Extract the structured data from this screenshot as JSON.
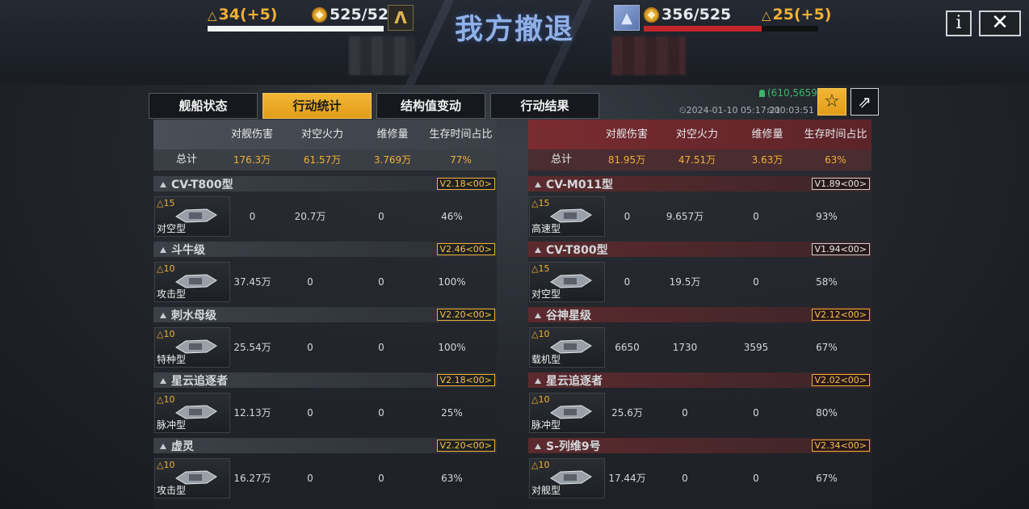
{
  "header": {
    "title": "我方撤退",
    "left": {
      "energy": "34(+5)",
      "hp": "525/525",
      "hp_fraction": 1.0,
      "emblem": "Λ"
    },
    "right": {
      "energy": "25(+5)",
      "hp": "356/525",
      "hp_fraction": 0.678,
      "emblem": "▲"
    },
    "info_label": "i",
    "close_label": "✕",
    "energy_prefix": "△"
  },
  "tabs": [
    {
      "label": "舰船状态",
      "active": false
    },
    {
      "label": "行动统计",
      "active": true
    },
    {
      "label": "结构值变动",
      "active": false
    },
    {
      "label": "行动结果",
      "active": false
    }
  ],
  "meta": {
    "code": "(610,5659)",
    "timestamp": "⏲2024-01-10 05:17:21",
    "duration": "⏲00:03:51",
    "fav_icon": "☆",
    "share_icon": "⇗"
  },
  "columns": [
    "",
    "对舰伤害",
    "对空火力",
    "维修量",
    "生存时间占比"
  ],
  "colors": {
    "accent": "#f0b035",
    "enemy": "#c5242b",
    "ally_bar": "#f2f2f2"
  },
  "left_panel": {
    "total": {
      "label": "总计",
      "dmg": "176.3万",
      "aa": "61.57万",
      "repair": "3.769万",
      "survival": "77%"
    },
    "ships": [
      {
        "name": "CV-T800型",
        "ver": "V2.18<00>",
        "gold": true,
        "lvl": "△15",
        "role": "对空型",
        "dmg": "0",
        "aa": "20.7万",
        "repair": "0",
        "survival": "46%"
      },
      {
        "name": "斗牛级",
        "ver": "V2.46<00>",
        "gold": true,
        "lvl": "△10",
        "role": "攻击型",
        "dmg": "37.45万",
        "aa": "0",
        "repair": "0",
        "survival": "100%"
      },
      {
        "name": "刺水母级",
        "ver": "V2.20<00>",
        "gold": true,
        "lvl": "△10",
        "role": "特种型",
        "dmg": "25.54万",
        "aa": "0",
        "repair": "0",
        "survival": "100%"
      },
      {
        "name": "星云追逐者",
        "ver": "V2.18<00>",
        "gold": true,
        "lvl": "△10",
        "role": "脉冲型",
        "dmg": "12.13万",
        "aa": "0",
        "repair": "0",
        "survival": "25%"
      },
      {
        "name": "虚灵",
        "ver": "V2.20<00>",
        "gold": true,
        "lvl": "△10",
        "role": "攻击型",
        "dmg": "16.27万",
        "aa": "0",
        "repair": "0",
        "survival": "63%"
      }
    ]
  },
  "right_panel": {
    "total": {
      "label": "总计",
      "dmg": "81.95万",
      "aa": "47.51万",
      "repair": "3.63万",
      "survival": "63%"
    },
    "ships": [
      {
        "name": "CV-M011型",
        "ver": "V1.89<00>",
        "gold": false,
        "lvl": "△15",
        "role": "高速型",
        "dmg": "0",
        "aa": "9.657万",
        "repair": "0",
        "survival": "93%"
      },
      {
        "name": "CV-T800型",
        "ver": "V1.94<00>",
        "gold": false,
        "lvl": "△15",
        "role": "对空型",
        "dmg": "0",
        "aa": "19.5万",
        "repair": "0",
        "survival": "58%"
      },
      {
        "name": "谷神星级",
        "ver": "V2.12<00>",
        "gold": true,
        "lvl": "△10",
        "role": "载机型",
        "dmg": "6650",
        "aa": "1730",
        "repair": "3595",
        "survival": "67%"
      },
      {
        "name": "星云追逐者",
        "ver": "V2.02<00>",
        "gold": true,
        "lvl": "△10",
        "role": "脉冲型",
        "dmg": "25.6万",
        "aa": "0",
        "repair": "0",
        "survival": "80%"
      },
      {
        "name": "S-列维9号",
        "ver": "V2.34<00>",
        "gold": true,
        "lvl": "△10",
        "role": "对舰型",
        "dmg": "17.44万",
        "aa": "0",
        "repair": "0",
        "survival": "67%"
      }
    ]
  }
}
